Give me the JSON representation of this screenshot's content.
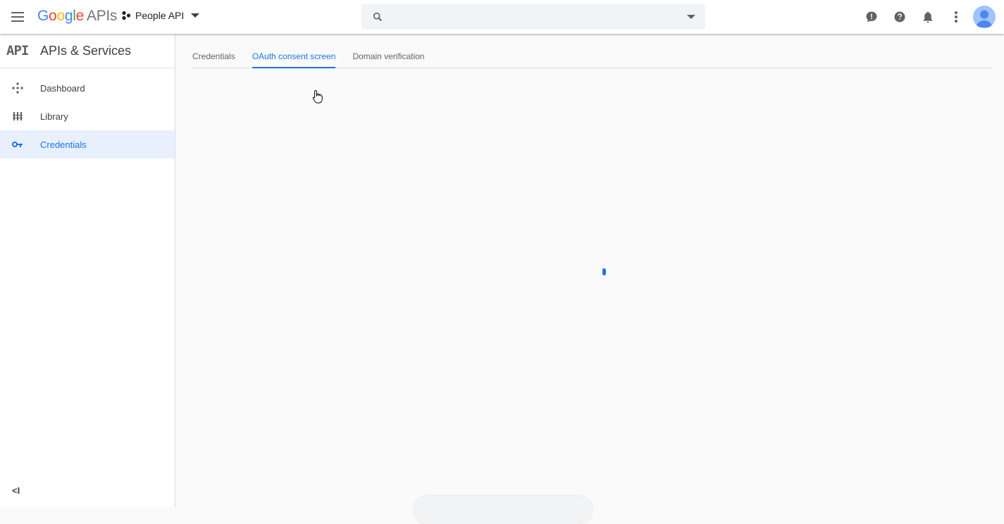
{
  "topbar": {
    "logo_letters": [
      "G",
      "o",
      "o",
      "g",
      "l",
      "e"
    ],
    "logo_apis": "APIs",
    "project_name": "People API",
    "search_placeholder": "",
    "icons": [
      "feedback-icon",
      "help-icon",
      "notifications-icon",
      "more-vert-icon",
      "account-avatar"
    ]
  },
  "sidebar": {
    "api_glyph": "API",
    "title": "APIs & Services",
    "items": [
      {
        "label": "Dashboard",
        "icon": "dashboard-icon"
      },
      {
        "label": "Library",
        "icon": "library-icon"
      },
      {
        "label": "Credentials",
        "icon": "key-icon",
        "active": true
      }
    ],
    "collapse_glyph": "<I"
  },
  "tabs": [
    {
      "label": "Credentials"
    },
    {
      "label": "OAuth consent screen",
      "active": true
    },
    {
      "label": "Domain verification"
    }
  ],
  "colors": {
    "accent": "#1a73e8",
    "active_bg": "#e8f0fe",
    "icon_gray": "#5f6368"
  }
}
